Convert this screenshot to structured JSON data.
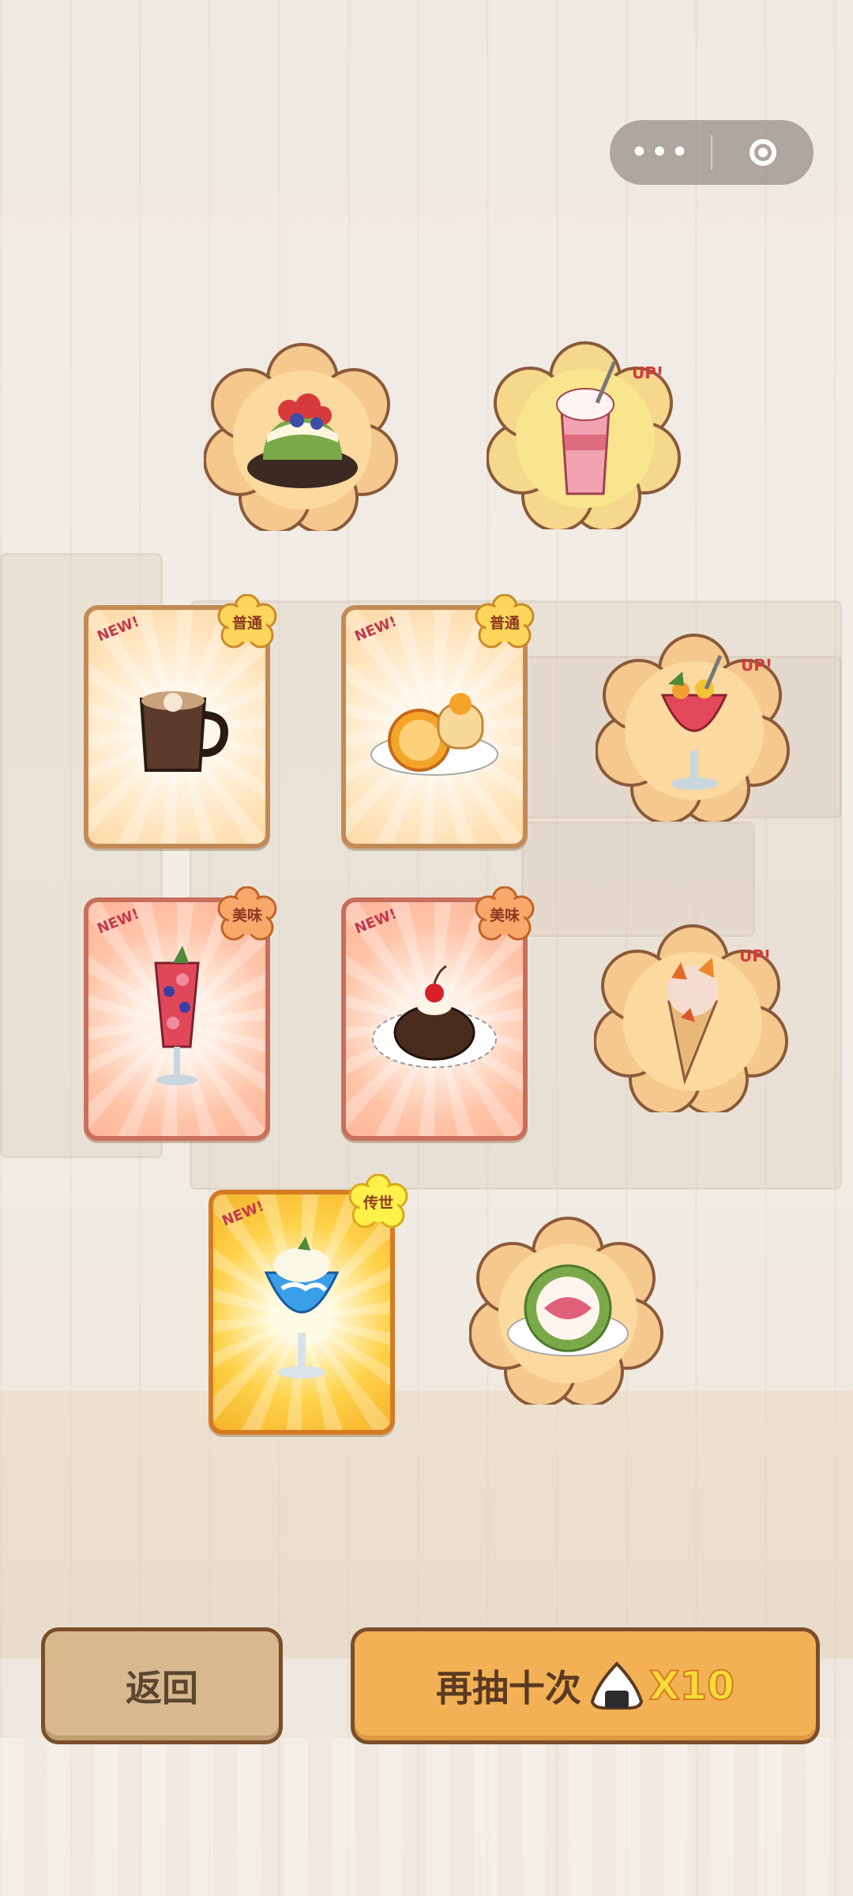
{
  "capsule": {
    "more_icon": "more-dots-icon",
    "close_icon": "target-close-icon"
  },
  "featured": [
    {
      "name": "strawberry-matcha-cake",
      "up": ""
    },
    {
      "name": "strawberry-milkshake",
      "up": "UP!"
    },
    {
      "name": "fruit-punch",
      "up": "UP!"
    },
    {
      "name": "autumn-leaf-ice-cream-cone",
      "up": "UP!"
    },
    {
      "name": "matcha-strawberry-roll",
      "up": ""
    }
  ],
  "cards": [
    {
      "item": "cat-latte",
      "rarity": "普通",
      "new": "NEW!"
    },
    {
      "item": "orange-roll-cake",
      "rarity": "普通",
      "new": "NEW!"
    },
    {
      "item": "berry-parfait",
      "rarity": "美味",
      "new": "NEW!"
    },
    {
      "item": "chocolate-cherry-cake",
      "rarity": "美味",
      "new": "NEW!"
    },
    {
      "item": "blue-cream-soda",
      "rarity": "传世",
      "new": "NEW!"
    }
  ],
  "buttons": {
    "back_label": "返回",
    "again_label": "再抽十次",
    "cost_icon": "rice-ball-icon",
    "cost": "X10"
  },
  "colors": {
    "normal": "#ffe3bb",
    "tasty": "#ffc4a8",
    "legend": "#ffd24a",
    "button_primary": "#f2b155",
    "button_secondary": "#d8b98e"
  }
}
